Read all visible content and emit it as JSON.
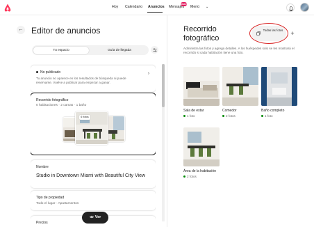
{
  "header": {
    "nav": [
      "Hoy",
      "Calendario",
      "Anuncios",
      "Mensajes",
      "Menú"
    ],
    "active": "Anuncios",
    "messages_badge": "Nuevo",
    "colors": {
      "brand": "#ff385c",
      "badge": "#e31c5f"
    }
  },
  "editor": {
    "title": "Editor de anuncios",
    "tabs": [
      "Tu espacio",
      "Guía de llegada"
    ],
    "selected_tab": "Tu espacio"
  },
  "status_card": {
    "title": "No publicado",
    "body": "Tu anuncio no aparece en los resultados de búsqueda ni puede reservarse. Vuelve a publicar para empezar a ganar."
  },
  "photo_tour_card": {
    "title": "Recorrido fotográfico",
    "subtitle": "0 habitaciones · 2 camas · 1 baño",
    "photo_count": "6 fotos"
  },
  "name_card": {
    "label": "Nombre",
    "value": "Studio in Downtown Miami with Beautiful City View"
  },
  "property_card": {
    "label": "Tipo de propiedad",
    "value": "Todo el lugar · Apartamentos"
  },
  "prices_card": {
    "label": "Precios"
  },
  "view_button": "Ver",
  "right": {
    "title": "Recorrido fotográfico",
    "all_photos": "Todas las fotos",
    "description": "Administra las fotos y agrega detalles. A los huéspedes solo se les mostrará el recorrido si cada habitación tiene una foto.",
    "rooms": [
      {
        "name": "Sala de estar",
        "count": "1 foto"
      },
      {
        "name": "Comedor",
        "count": "2 fotos"
      },
      {
        "name": "Baño completo",
        "count": "1 foto"
      },
      {
        "name": "Área de la habitación",
        "count": "2 fotos"
      }
    ]
  }
}
